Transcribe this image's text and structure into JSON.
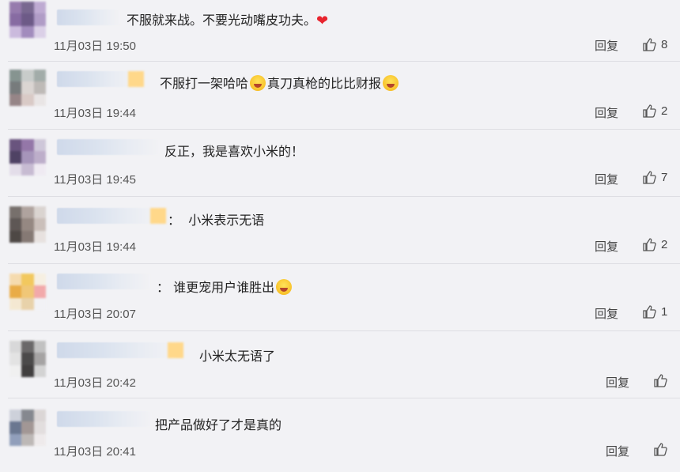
{
  "comments": [
    {
      "text": "不服就来战。不要光动嘴皮功夫。",
      "suffix": "❤",
      "date": "11月03日 19:50",
      "reply": "回复",
      "likes": "8"
    },
    {
      "text": "不服打一架哈哈",
      "middle": "真刀真枪的比比财报",
      "date": "11月03日 19:44",
      "reply": "回复",
      "likes": "2"
    },
    {
      "text": "反正，我是喜欢小米的！",
      "date": "11月03日 19:45",
      "reply": "回复",
      "likes": "7"
    },
    {
      "prefix": "：",
      "text": "小米表示无语",
      "date": "11月03日 19:44",
      "reply": "回复",
      "likes": "2"
    },
    {
      "prefix": "：",
      "text": "谁更宠用户谁胜出",
      "date": "11月03日 20:07",
      "reply": "回复",
      "likes": "1"
    },
    {
      "text": "小米太无语了",
      "date": "11月03日 20:42",
      "reply": "回复",
      "likes": ""
    },
    {
      "text": "把产品做好了才是真的",
      "date": "11月03日 20:41",
      "reply": "回复",
      "likes": ""
    }
  ],
  "icons": {
    "like": "thumbs-up-icon",
    "heart": "heart-icon",
    "emoji": "laughing-emoji-icon",
    "hug": "hug-emoji-icon"
  }
}
